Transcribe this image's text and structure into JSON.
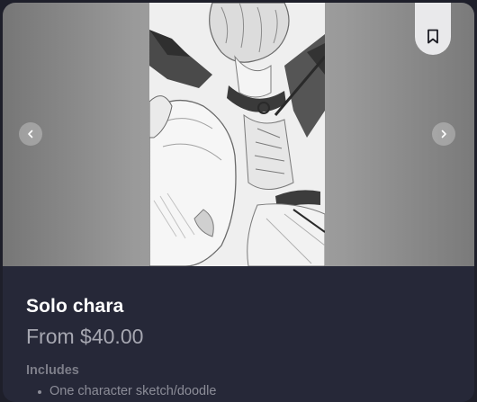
{
  "listing": {
    "title": "Solo chara",
    "price": "From $40.00",
    "includes_heading": "Includes",
    "includes": [
      "One character sketch/doodle"
    ]
  },
  "gallery": {
    "prev_icon": "chevron-left-icon",
    "next_icon": "chevron-right-icon",
    "bookmark_icon": "bookmark-icon"
  },
  "colors": {
    "page_background": "#1e1f2a",
    "card_background": "#262838",
    "title": "#ffffff",
    "price": "#a6a7b1",
    "muted_text": "#8c8d98"
  }
}
